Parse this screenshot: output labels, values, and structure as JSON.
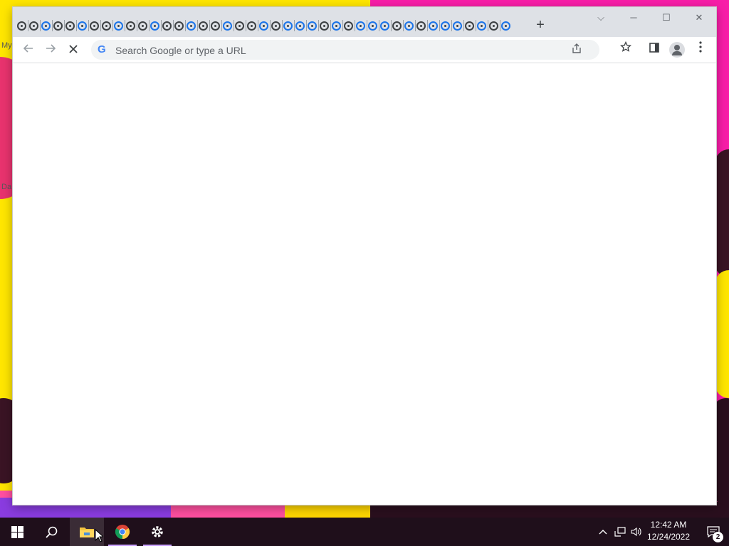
{
  "desktop": {
    "labels": [
      "My",
      "Da"
    ]
  },
  "browser": {
    "tab_count": 46,
    "omnibox": {
      "placeholder": "Search Google or type a URL",
      "value": ""
    },
    "buttons": {
      "back": "back-icon",
      "forward": "forward-icon",
      "stop": "stop-icon",
      "new_tab": "+",
      "share": "share-icon",
      "bookmark": "star-icon",
      "side_panel": "side-panel-icon",
      "profile": "profile-icon",
      "menu": "kebab-menu-icon"
    },
    "window_controls": {
      "tab_search": "⌵",
      "minimize": "─",
      "maximize": "☐",
      "close": "✕"
    }
  },
  "taskbar": {
    "clock_time": "12:42 AM",
    "clock_date": "12/24/2022",
    "notification_count": "2",
    "apps": [
      "start",
      "search",
      "file-explorer",
      "chrome",
      "settings"
    ]
  },
  "colors": {
    "titlebar": "#dee1e6",
    "taskbar": "#1f0f1b",
    "accent_blue": "#1a73e8"
  }
}
